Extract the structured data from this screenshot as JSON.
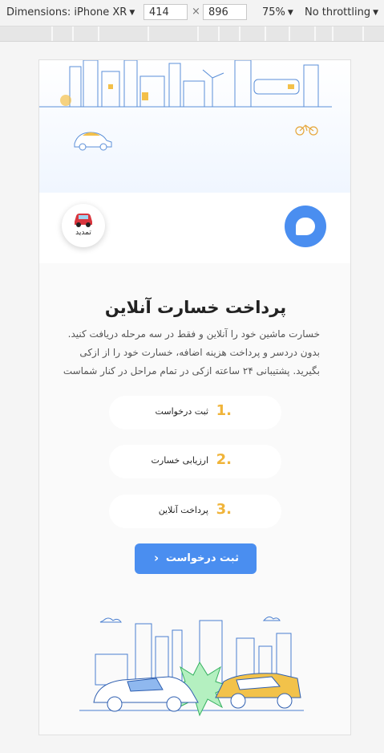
{
  "devtools": {
    "dimensions_label": "Dimensions: iPhone XR",
    "width": "414",
    "times": "×",
    "height": "896",
    "zoom": "75%",
    "throttling": "No throttling"
  },
  "header": {
    "renew_label": "تمدید",
    "logo_icon": "speech-bubble-icon",
    "brand_color": "#4a8ef0"
  },
  "main": {
    "title": "پرداخت خسارت آنلاین",
    "description": "خسارت ماشین خود را آنلاین و فقط در سه مرحله دریافت کنید. بدون دردسر و پرداخت هزینه اضافه، خسارت خود را از ازکی بگیرید. پشتیبانی ۲۴ ساعته ازکی در تمام مراحل در کنار شماست",
    "steps": [
      {
        "num": "1.",
        "label": "ثبت درخواست"
      },
      {
        "num": "2.",
        "label": "ارزیابی خسارت"
      },
      {
        "num": "3.",
        "label": "پرداخت آنلاین"
      }
    ],
    "cta_label": "ثبت درخواست",
    "cta_icon": "chevron-left-icon",
    "accent_color": "#f0b43a"
  }
}
